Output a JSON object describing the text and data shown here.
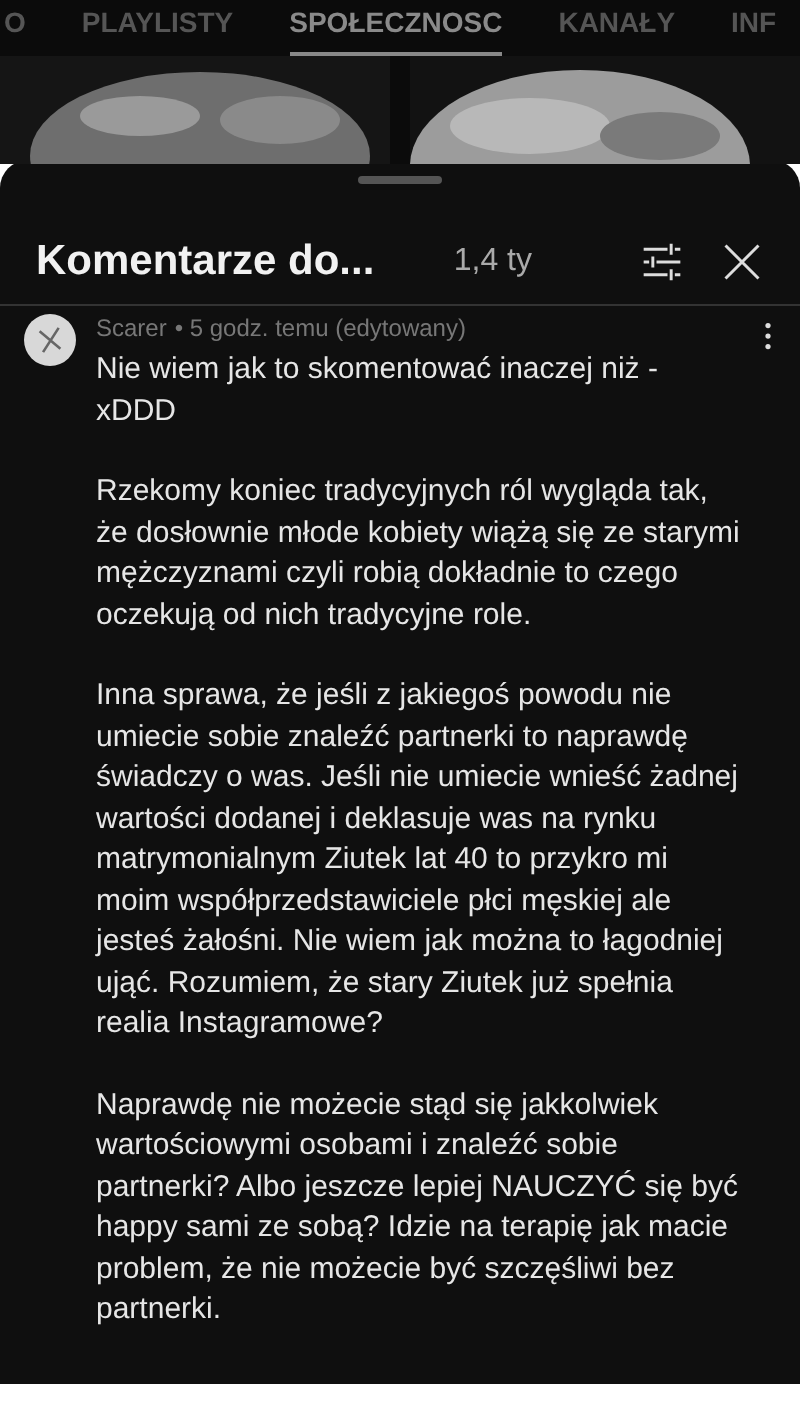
{
  "tabs": [
    {
      "label": "O",
      "selected": false
    },
    {
      "label": "PLAYLISTY",
      "selected": false
    },
    {
      "label": "SPOŁECZNOSC",
      "selected": true
    },
    {
      "label": "KANAŁY",
      "selected": false
    },
    {
      "label": "INF",
      "selected": false
    }
  ],
  "header": {
    "title": "Komentarze do...",
    "count": "1,4 ty"
  },
  "comment": {
    "author": "Scarer",
    "time": "• 5 godz. temu (edytowany)",
    "paragraphs": [
      "Nie wiem jak to skomentować inaczej niż - xDDD",
      "Rzekomy koniec tradycyjnych ról wygląda tak, że dosłownie młode kobiety wiążą się ze starymi mężczyznami czyli robią dokładnie to czego oczekują od nich tradycyjne role.",
      "Inna sprawa, że jeśli z jakiegoś powodu nie umiecie sobie znaleźć partnerki to naprawdę świadczy o was. Jeśli nie umiecie wnieść żadnej wartości dodanej i deklasuje was na rynku matrymonialnym Ziutek lat 40 to przykro mi moim współprzedstawiciele płci męskiej ale jesteś żałośni. Nie wiem jak można to łagodniej ująć. Rozumiem, że stary Ziutek już spełnia realia Instagramowe?",
      "Naprawdę nie możecie stąd się jakkolwiek wartościowymi osobami i znaleźć sobie partnerki? Albo jeszcze lepiej NAUCZYĆ się być happy sami ze sobą? Idzie na terapię jak macie problem, że nie możecie być szczęśliwi bez partnerki."
    ]
  }
}
